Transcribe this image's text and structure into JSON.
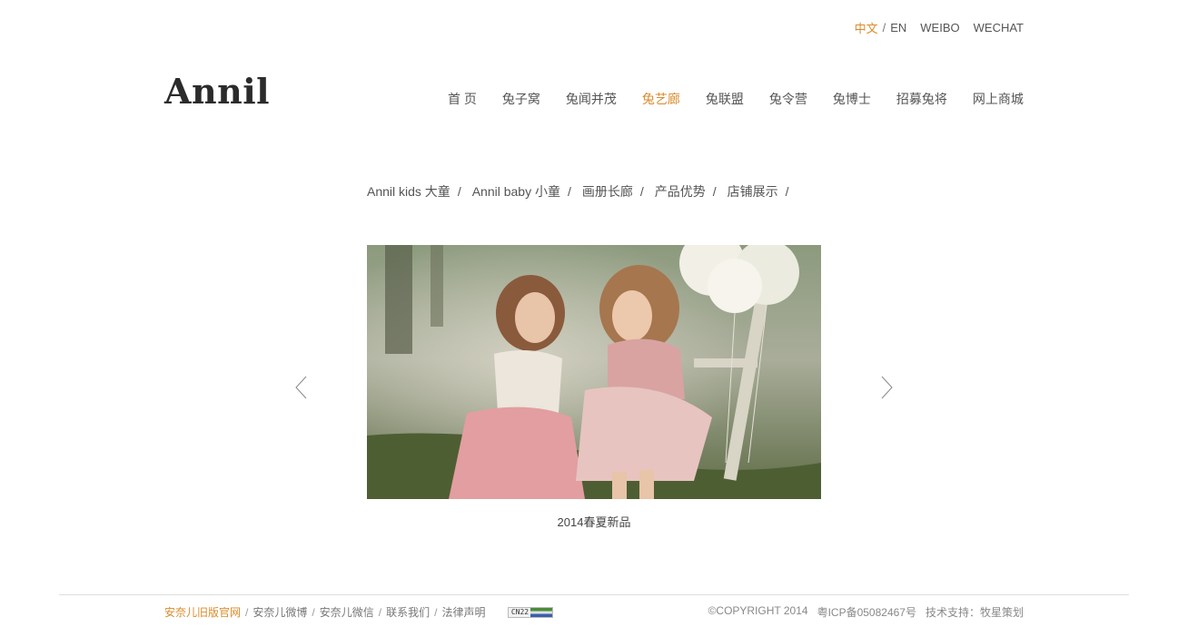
{
  "topbar": {
    "lang_zh": "中文",
    "separator": "/",
    "lang_en": "EN",
    "weibo": "WEIBO",
    "wechat": "WECHAT"
  },
  "logo": "Annil",
  "nav": {
    "items": [
      {
        "label": "首 页"
      },
      {
        "label": "兔子窝"
      },
      {
        "label": "兔闻并茂"
      },
      {
        "label": "兔艺廊",
        "active": true
      },
      {
        "label": "兔联盟"
      },
      {
        "label": "兔令营"
      },
      {
        "label": "兔博士"
      },
      {
        "label": "招募兔将"
      },
      {
        "label": "网上商城"
      }
    ]
  },
  "subnav": {
    "items": [
      {
        "label": "Annil kids 大童"
      },
      {
        "label": "Annil baby 小童"
      },
      {
        "label": "画册长廊"
      },
      {
        "label": "产品优势"
      },
      {
        "label": "店铺展示"
      }
    ],
    "separator": "/"
  },
  "slider": {
    "caption": "2014春夏新品",
    "prev_icon": "chevron-left-icon",
    "next_icon": "chevron-right-icon"
  },
  "footer": {
    "links": [
      {
        "label": "安奈儿旧版官网",
        "highlight": true
      },
      {
        "label": "安奈儿微博"
      },
      {
        "label": "安奈儿微信"
      },
      {
        "label": "联系我们"
      },
      {
        "label": "法律声明"
      }
    ],
    "separator": "/",
    "badge_text": "CN22",
    "copyright": "©COPYRIGHT 2014",
    "icp": "粤ICP备05082467号",
    "tech_support": "技术支持：牧星策划"
  },
  "colors": {
    "accent": "#d98b2b",
    "text": "#555555",
    "footer_line": "#dddddd"
  }
}
